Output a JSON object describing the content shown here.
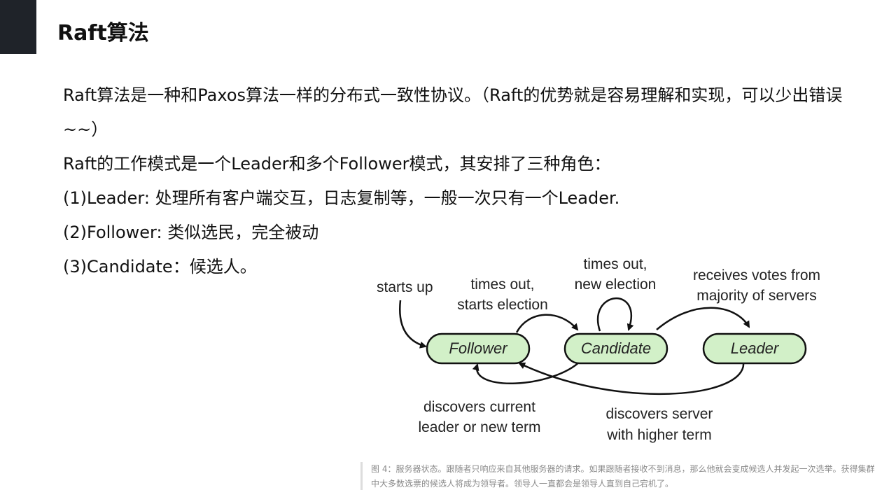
{
  "title": "Raft算法",
  "paragraphs": [
    "Raft算法是一种和Paxos算法一样的分布式一致性协议。（Raft的优势就是容易理解和实现，可以少出错误~~）",
    "Raft的工作模式是一个Leader和多个Follower模式，其安排了三种角色：",
    "(1)Leader: 处理所有客户端交互，日志复制等，一般一次只有一个Leader.",
    "(2)Follower: 类似选民，完全被动",
    "(3)Candidate：候选人。"
  ],
  "diagram": {
    "states": {
      "follower": "Follower",
      "candidate": "Candidate",
      "leader": "Leader"
    },
    "labels": {
      "starts_up": "starts up",
      "times_out_starts_1": "times out,",
      "times_out_starts_2": "starts election",
      "times_out_new_1": "times out,",
      "times_out_new_2": "new election",
      "receives_votes_1": "receives votes from",
      "receives_votes_2": "majority of servers",
      "discovers_current_1": "discovers current",
      "discovers_current_2": "leader or new term",
      "discovers_server_1": "discovers server",
      "discovers_server_2": "with higher term"
    },
    "colors": {
      "state_fill": "#d2f0c8",
      "state_stroke": "#111111",
      "edge": "#111111"
    }
  },
  "caption": "图 4：服务器状态。跟随者只响应来自其他服务器的请求。如果跟随者接收不到消息，那么他就会变成候选人并发起一次选举。获得集群中大多数选票的候选人将成为领导者。领导人一直都会是领导人直到自己宕机了。",
  "accent_color": "#1f2329"
}
